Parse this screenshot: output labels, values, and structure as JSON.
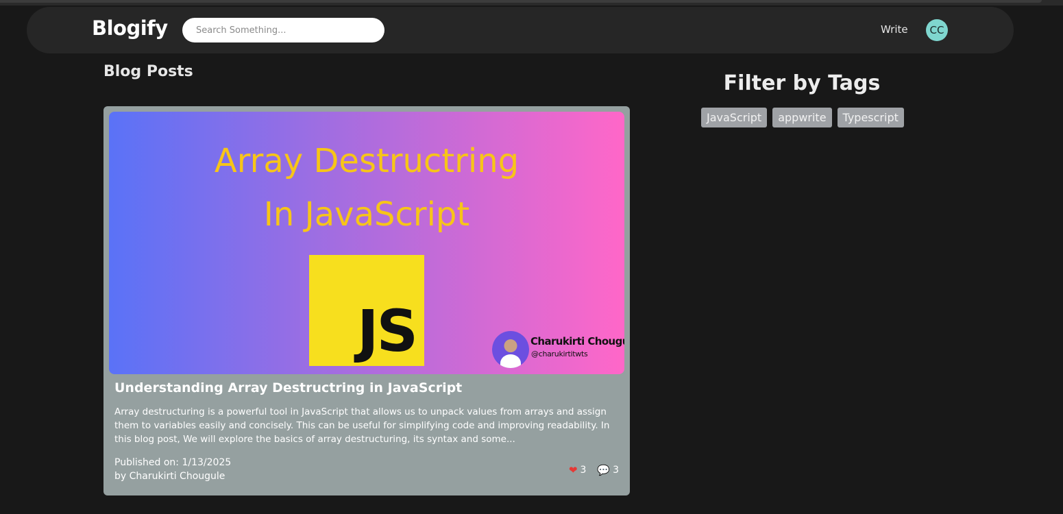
{
  "app": {
    "brand": "Blogify"
  },
  "header": {
    "search_placeholder": "Search Something...",
    "write_label": "Write",
    "avatar_initials": "CC"
  },
  "main": {
    "section_title": "Blog Posts",
    "posts": [
      {
        "image": {
          "headline_line1": "Array Destructring",
          "headline_line2": "In JavaScript",
          "logo_text": "JS",
          "author_name": "Charukirti Chougule",
          "author_handle": "@charukirtitwts"
        },
        "title": "Understanding Array Destructring in JavaScript",
        "excerpt": "Array destructuring is a powerful tool in JavaScript that allows us to unpack values from arrays and assign them to variables easily and concisely. This can be useful for simplifying code and improving readability. In this blog post, We will explore the basics of array destructuring, its syntax and some...",
        "published": "Published on: 1/13/2025",
        "author": "by Charukirti Chougule",
        "likes": "3",
        "comments": "3",
        "like_icon": "heart-icon",
        "comment_icon": "comment-icon"
      }
    ]
  },
  "sidebar": {
    "filter_title": "Filter by Tags",
    "tags": [
      "JavaScript",
      "appwrite",
      "Typescript"
    ]
  },
  "colors": {
    "background": "#181818",
    "navbar": "#262626",
    "card": "#95a0a0",
    "tag": "#9fa2a6",
    "avatar": "#7fd6cf",
    "headline": "#f7c518",
    "js_logo": "#f7df1e"
  }
}
